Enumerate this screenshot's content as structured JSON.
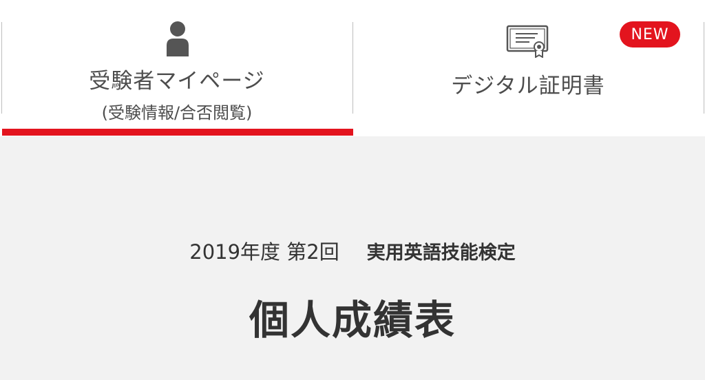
{
  "tabs": [
    {
      "label": "受験者マイページ",
      "sublabel": "(受験情報/合否閲覧)",
      "icon": "person-icon",
      "active": true
    },
    {
      "label": "デジタル証明書",
      "icon": "certificate-icon",
      "badge": "NEW",
      "active": false
    }
  ],
  "header": {
    "session": "2019年度 第2回",
    "exam_name": "実用英語技能検定",
    "title": "個人成績表"
  },
  "colors": {
    "accent": "#e3141e",
    "background": "#f2f2f2",
    "text": "#333333"
  }
}
